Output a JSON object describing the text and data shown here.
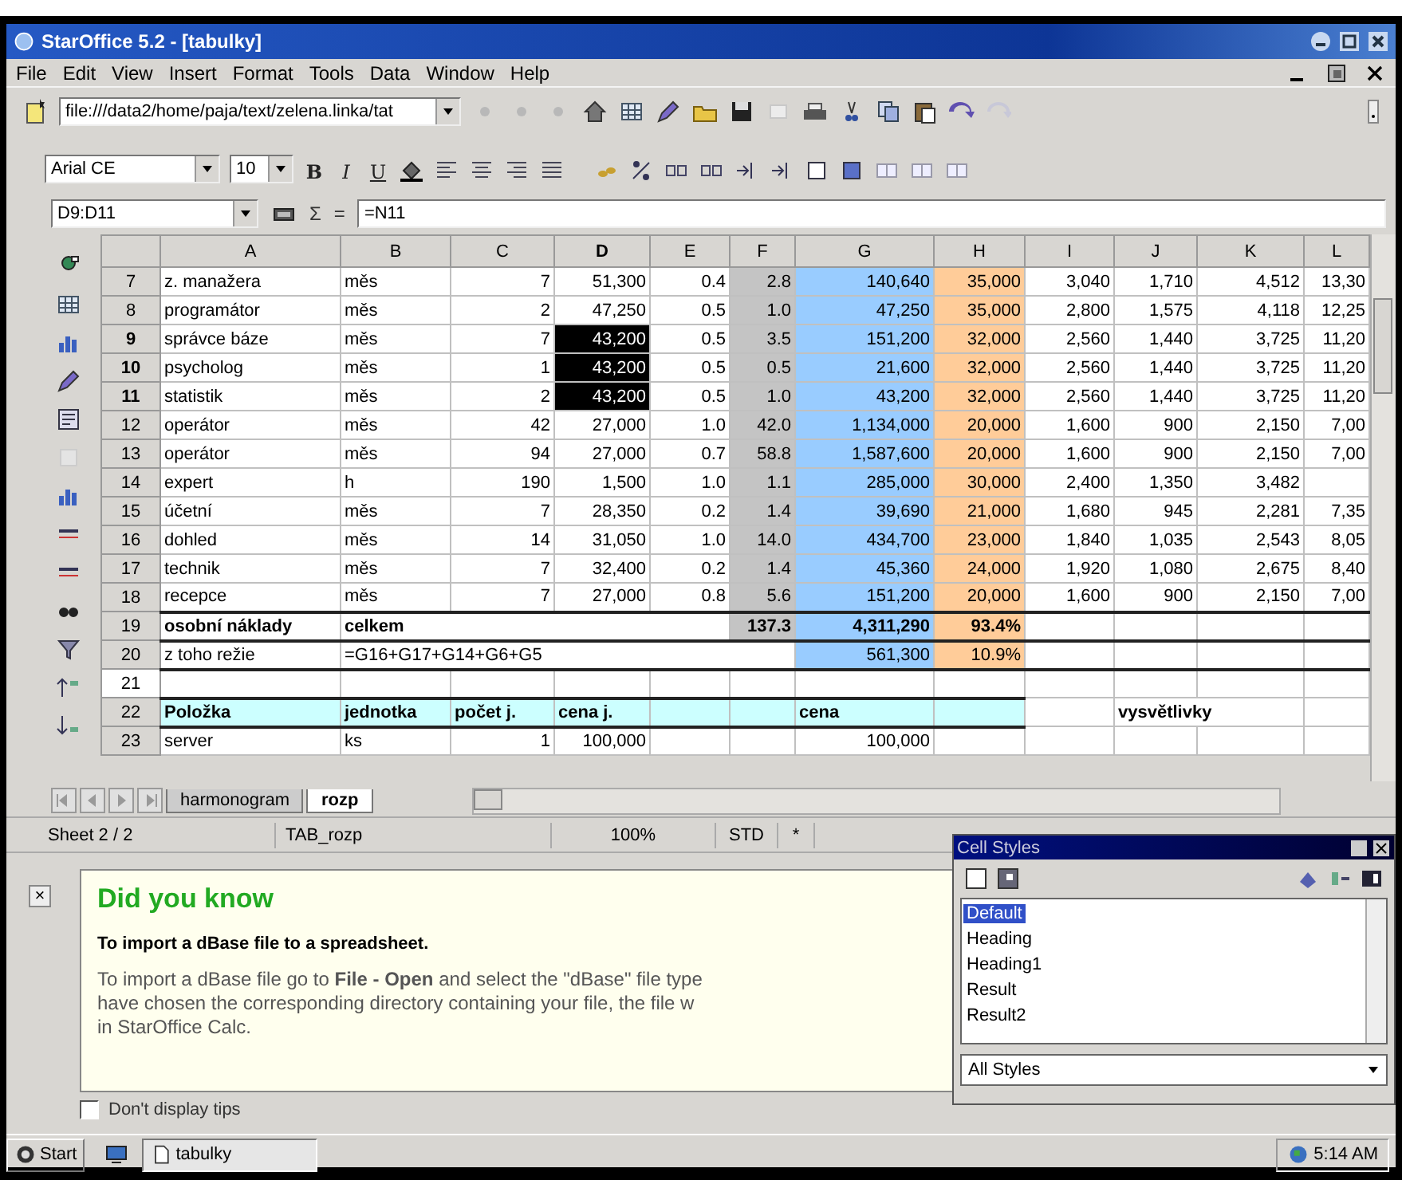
{
  "window": {
    "title": "StarOffice 5.2 - [tabulky]"
  },
  "menu": [
    "File",
    "Edit",
    "View",
    "Insert",
    "Format",
    "Tools",
    "Data",
    "Window",
    "Help"
  ],
  "url_field": {
    "value": "file:///data2/home/paja/text/zelena.linka/tat"
  },
  "font_name": {
    "value": "Arial CE"
  },
  "font_size": {
    "value": "10"
  },
  "format_buttons": [
    "B",
    "I",
    "U"
  ],
  "name_box": {
    "value": "D9:D11"
  },
  "formula_bar": {
    "sum": "Σ",
    "equals": "=",
    "value": "=N11"
  },
  "sheet": {
    "columns": [
      {
        "label": "A",
        "selected": false
      },
      {
        "label": "B",
        "selected": false
      },
      {
        "label": "C",
        "selected": false
      },
      {
        "label": "D",
        "selected": true
      },
      {
        "label": "E",
        "selected": false
      },
      {
        "label": "F",
        "selected": false,
        "color": "#c4c4c4"
      },
      {
        "label": "G",
        "selected": false,
        "color": "#99ccff"
      },
      {
        "label": "H",
        "selected": false,
        "color": "#ffcc99"
      },
      {
        "label": "I",
        "selected": false
      },
      {
        "label": "J",
        "selected": false
      },
      {
        "label": "K",
        "selected": false
      },
      {
        "label": "L",
        "selected": false
      }
    ],
    "rows": [
      {
        "header": "7",
        "selected": false,
        "kind": "data",
        "bold": false,
        "cells": [
          "z. manažera",
          "měs",
          "7",
          "51,300",
          "0.4",
          "2.8",
          "140,640",
          "35,000",
          "3,040",
          "1,710",
          "4,512",
          "13,30"
        ]
      },
      {
        "header": "8",
        "selected": false,
        "kind": "data",
        "bold": false,
        "cells": [
          "programátor",
          "měs",
          "2",
          "47,250",
          "0.5",
          "1.0",
          "47,250",
          "35,000",
          "2,800",
          "1,575",
          "4,118",
          "12,25"
        ]
      },
      {
        "header": "9",
        "selected": true,
        "kind": "data",
        "bold": false,
        "cells": [
          "správce báze",
          "měs",
          "7",
          "43,200",
          "0.5",
          "3.5",
          "151,200",
          "32,000",
          "2,560",
          "1,440",
          "3,725",
          "11,20"
        ]
      },
      {
        "header": "10",
        "selected": true,
        "kind": "data",
        "bold": false,
        "cells": [
          "psycholog",
          "měs",
          "1",
          "43,200",
          "0.5",
          "0.5",
          "21,600",
          "32,000",
          "2,560",
          "1,440",
          "3,725",
          "11,20"
        ]
      },
      {
        "header": "11",
        "selected": true,
        "kind": "data",
        "bold": false,
        "cells": [
          "statistik",
          "měs",
          "2",
          "43,200",
          "0.5",
          "1.0",
          "43,200",
          "32,000",
          "2,560",
          "1,440",
          "3,725",
          "11,20"
        ]
      },
      {
        "header": "12",
        "selected": false,
        "kind": "data",
        "bold": false,
        "cells": [
          "operátor",
          "měs",
          "42",
          "27,000",
          "1.0",
          "42.0",
          "1,134,000",
          "20,000",
          "1,600",
          "900",
          "2,150",
          "7,00"
        ]
      },
      {
        "header": "13",
        "selected": false,
        "kind": "data",
        "bold": false,
        "cells": [
          "operátor",
          "měs",
          "94",
          "27,000",
          "0.7",
          "58.8",
          "1,587,600",
          "20,000",
          "1,600",
          "900",
          "2,150",
          "7,00"
        ]
      },
      {
        "header": "14",
        "selected": false,
        "kind": "data",
        "bold": false,
        "cells": [
          "expert",
          "h",
          "190",
          "1,500",
          "1.0",
          "1.1",
          "285,000",
          "30,000",
          "2,400",
          "1,350",
          "3,482"
        ]
      },
      {
        "header": "15",
        "selected": false,
        "kind": "data",
        "bold": false,
        "cells": [
          "účetní",
          "měs",
          "7",
          "28,350",
          "0.2",
          "1.4",
          "39,690",
          "21,000",
          "1,680",
          "945",
          "2,281",
          "7,35"
        ]
      },
      {
        "header": "16",
        "selected": false,
        "kind": "data",
        "bold": false,
        "cells": [
          "dohled",
          "měs",
          "14",
          "31,050",
          "1.0",
          "14.0",
          "434,700",
          "23,000",
          "1,840",
          "1,035",
          "2,543",
          "8,05"
        ]
      },
      {
        "header": "17",
        "selected": false,
        "kind": "data",
        "bold": false,
        "cells": [
          "technik",
          "měs",
          "7",
          "32,400",
          "0.2",
          "1.4",
          "45,360",
          "24,000",
          "1,920",
          "1,080",
          "2,675",
          "8,40"
        ]
      },
      {
        "header": "18",
        "selected": false,
        "kind": "data",
        "bold": false,
        "cells": [
          "recepce",
          "měs",
          "7",
          "27,000",
          "0.8",
          "5.6",
          "151,200",
          "20,000",
          "1,600",
          "900",
          "2,150",
          "7,00"
        ]
      },
      {
        "header": "19",
        "selected": false,
        "kind": "total",
        "bold": true,
        "cells": [
          "osobní náklady",
          "celkem",
          null,
          null,
          null,
          "137.3",
          "4,311,290",
          "93.4%"
        ]
      },
      {
        "header": "20",
        "selected": false,
        "kind": "subtotal",
        "bold": false,
        "cells": [
          "z toho režie",
          "=G16+G17+G14+G6+G5",
          null,
          null,
          null,
          null,
          "561,300",
          "10.9%"
        ]
      },
      {
        "header": "21",
        "selected": false,
        "kind": "blank"
      },
      {
        "header": "22",
        "selected": false,
        "kind": "heading",
        "bold": true,
        "cells": [
          "Položka",
          "jednotka",
          "počet j.",
          "cena j.",
          null,
          null,
          "cena",
          null,
          null,
          "vysvětlivky"
        ]
      },
      {
        "header": "23",
        "selected": false,
        "kind": "plain",
        "bold": false,
        "cells": [
          "server",
          "ks",
          "1",
          "100,000",
          null,
          null,
          "100,000"
        ]
      }
    ]
  },
  "sheet_tabs": [
    {
      "label": "harmonogram",
      "selected": false
    },
    {
      "label": "rozp",
      "selected": true
    }
  ],
  "status_bar": [
    "Sheet 2 / 2",
    "TAB_rozp",
    "100%",
    "STD",
    "*"
  ],
  "tip": {
    "close": "×",
    "title": "Did you know",
    "heading": "To import a dBase file to a spreadsheet.",
    "lines": [
      "To import a dBase file go to **File - Open** and select the \"dBase\" file type",
      "have chosen the corresponding directory containing your file, the file w",
      "in StarOffice Calc."
    ],
    "dont_display_tips": {
      "label": "Don't display tips",
      "checked": false
    }
  },
  "cell_styles": {
    "title": "Cell Styles",
    "items": [
      {
        "label": "Default",
        "selected": true
      },
      {
        "label": "Heading",
        "selected": false
      },
      {
        "label": "Heading1",
        "selected": false
      },
      {
        "label": "Result",
        "selected": false
      },
      {
        "label": "Result2",
        "selected": false
      }
    ],
    "filter": "All Styles"
  },
  "taskbar": {
    "start": "Start",
    "tasks": [
      "tabulky"
    ],
    "clock": "5:14 AM"
  }
}
